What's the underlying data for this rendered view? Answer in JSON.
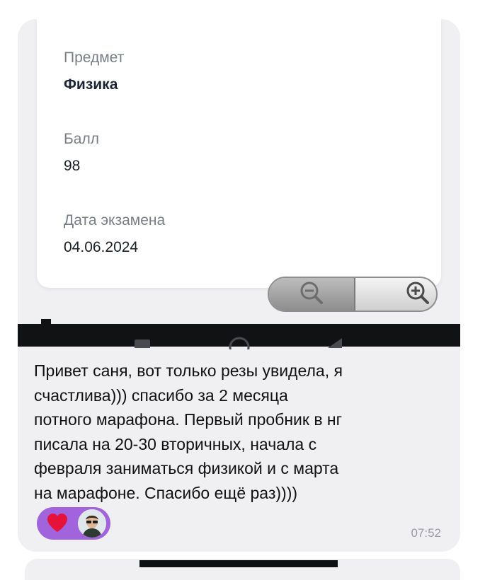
{
  "certificate": {
    "subject_label": "Предмет",
    "subject_value": "Физика",
    "score_label": "Балл",
    "score_value": "98",
    "date_label": "Дата экзамена",
    "date_value": "04.06.2024"
  },
  "zoom_control": {
    "out_icon": "zoom-out-icon",
    "in_icon": "zoom-in-icon"
  },
  "message": {
    "text": "Привет саня, вот только резы увидела, я\nсчастлива))) спасибо за 2 месяца\nпотного марафона. Первый пробник в нг\nписала на 20-30 вторичных, начала с\nфевраля заниматься физикой и с марта\nна марафоне. Спасибо ещё раз))))",
    "time": "07:52"
  },
  "reaction": {
    "emoji_icon": "heart-icon",
    "color": "#a264dd"
  },
  "colors": {
    "bubble": "#f0f0f3",
    "card": "#ffffff",
    "label": "#7a7d85",
    "heart": "#e5133a"
  }
}
